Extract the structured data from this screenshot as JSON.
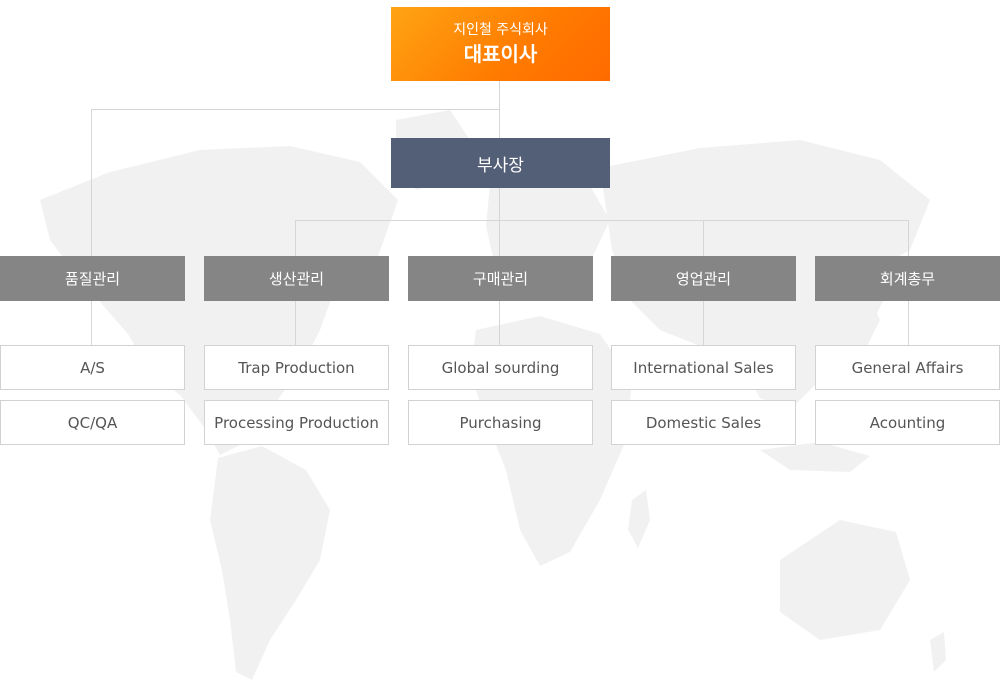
{
  "ceo": {
    "company": "지인철 주식회사",
    "title": "대표이사"
  },
  "vice_president": {
    "title": "부사장"
  },
  "departments": [
    {
      "name": "품질관리",
      "teams": [
        "A/S",
        "QC/QA"
      ]
    },
    {
      "name": "생산관리",
      "teams": [
        "Trap Production",
        "Processing Production"
      ]
    },
    {
      "name": "구매관리",
      "teams": [
        "Global sourding",
        "Purchasing"
      ]
    },
    {
      "name": "영업관리",
      "teams": [
        "International Sales",
        "Domestic Sales"
      ]
    },
    {
      "name": "회계총무",
      "teams": [
        "General Affairs",
        "Acounting"
      ]
    }
  ],
  "colors": {
    "ceo_gradient_start": "#ffa413",
    "ceo_gradient_end": "#ff6a00",
    "vice_president": "#535e77",
    "department": "#858585",
    "connector": "#d6d6d6",
    "map": "#f1f1f1"
  }
}
